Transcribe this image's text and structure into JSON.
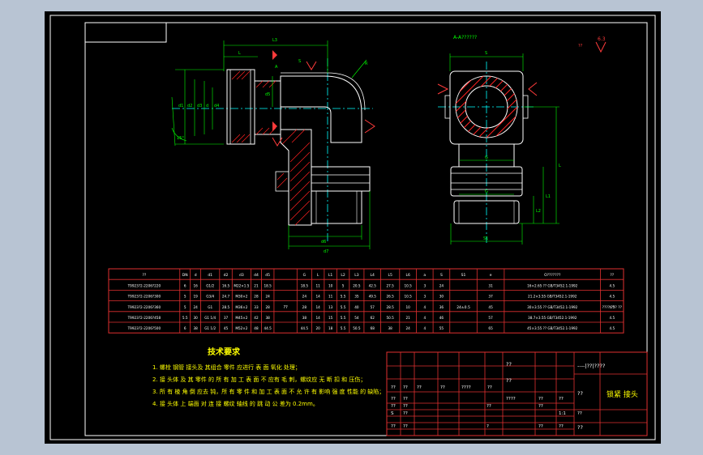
{
  "colors": {
    "background_outer": "#b8c4d3",
    "canvas": "#000000",
    "frame": "#ffffff",
    "table": "#e03030",
    "table_text": "#ffffff",
    "dimension": "#00ff00",
    "centerline": "#00ffff",
    "outline": "#ffffff",
    "hatch": "#ff2020",
    "note_text": "#ffff00",
    "marker": "#ff3b3b"
  },
  "section_label": "A-A??????",
  "surface_label": "6.3",
  "surface_label_left": "??",
  "views": {
    "left": {
      "dims": {
        "top": "L3",
        "top_left": "L",
        "top_mid": "A",
        "s_mark": "S",
        "r_mark": "R",
        "left_1": "d1",
        "left_2": "d2",
        "left_3": "d3",
        "left_4": "d",
        "left_5": "d4",
        "left_6": "d5",
        "angle": "15°",
        "bottom_1": "d6",
        "bottom_2": "d7"
      }
    },
    "right": {
      "dims": {
        "top": "S",
        "mid": "G",
        "low": "G",
        "right_1": "L",
        "right_2": "L1",
        "right_3": "L2",
        "bottom": "S1"
      }
    }
  },
  "spec_table": {
    "headers": [
      "??",
      "DN",
      "d",
      "d1",
      "d2",
      "d3",
      "d4",
      "d5",
      "G",
      "L",
      "L1",
      "L2",
      "L3",
      "L4",
      "L5",
      "L6",
      "a",
      "S",
      "S1",
      "e",
      "O???????",
      "??"
    ],
    "rows": [
      [
        "T9923?2-2206?220",
        "6",
        "16",
        "G1/2",
        "16.5",
        "M22×1.5",
        "21",
        "18.5",
        "",
        "18.5",
        "11",
        "10",
        "5",
        "20.5",
        "42.5",
        "27.5",
        "10.5",
        "3",
        "24",
        "",
        "31",
        "16×2.65 ?? GB/T3452.1-1992",
        "4.5"
      ],
      [
        "T9923?2-2206?300",
        "5",
        "19",
        "G3/4",
        "24.7",
        "M30×2",
        "28",
        "24",
        "",
        "24",
        "14",
        "11",
        "5.5",
        "35",
        "49.5",
        "26.5",
        "10.5",
        "3",
        "30",
        "",
        "37",
        "21.2×3.55 GB/T3452.1-1992",
        "4.5"
      ],
      [
        "T9923?2-2206?360",
        "5",
        "24",
        "G1",
        "28.5",
        "M36×2",
        "33",
        "28",
        "",
        "28",
        "14",
        "13",
        "5.5",
        "40",
        "57",
        "28.5",
        "10",
        "4",
        "36",
        "",
        "45",
        "30×3.55 ?? GB/T3452.1-1992",
        "4.5"
      ],
      [
        "T9923?2-2206?458",
        "5.5",
        "30",
        "G1 1/4",
        "37",
        "M45×2",
        "42",
        "38",
        "",
        "38",
        "14",
        "15",
        "5.5",
        "54",
        "62",
        "50.5",
        "21",
        "4",
        "46",
        "",
        "57",
        "38.7×3.55 GB/T3452.1-1992",
        "4.5"
      ],
      [
        "T9923?2-2206?500",
        "6",
        "38",
        "G1 1/2",
        "45",
        "M52×2",
        "48",
        "44.5",
        "",
        "44.5",
        "20",
        "18",
        "5.5",
        "50.5",
        "68",
        "38",
        "24",
        "4",
        "55",
        "",
        "65",
        "45×3.55 ?? GB/T3452.1-1992",
        "4.5"
      ]
    ],
    "merged_material": "??",
    "merged_tolerance": "24±0.5",
    "merged_remark": "???? ??? ??"
  },
  "notes": {
    "title": "技术要求",
    "items": [
      "1. 螺栓 钢管 接头及 其组合 零件 应进行 表 面 氧化 处理；",
      "2. 接 头体 及 其 零件 的 所 有 加 工 表 面 不 应有 毛 刺，螺纹应 无 断 扣 和 压伤；",
      "3. 所 有 棱 角 倒 应去 钝，所 有 零 件 和 加 工 表 面 不 允 许 有 影响 强 度 性能 的 缺陷；",
      "4. 接 头体 上 端面 对 连 接 螺纹 轴线 的 跳 动 公 差为 0.2mm。"
    ]
  },
  "title_block": {
    "top_right": "----|??|????",
    "part_name": "锁紧 接头",
    "cells": [
      "??",
      "??",
      "??",
      "??",
      "????",
      "??",
      "??",
      "??",
      "????",
      "??",
      "??",
      "??",
      "??",
      "??",
      "??",
      "S",
      "??",
      "1:1",
      "??",
      "??",
      "??",
      "?",
      "??",
      "??"
    ]
  }
}
